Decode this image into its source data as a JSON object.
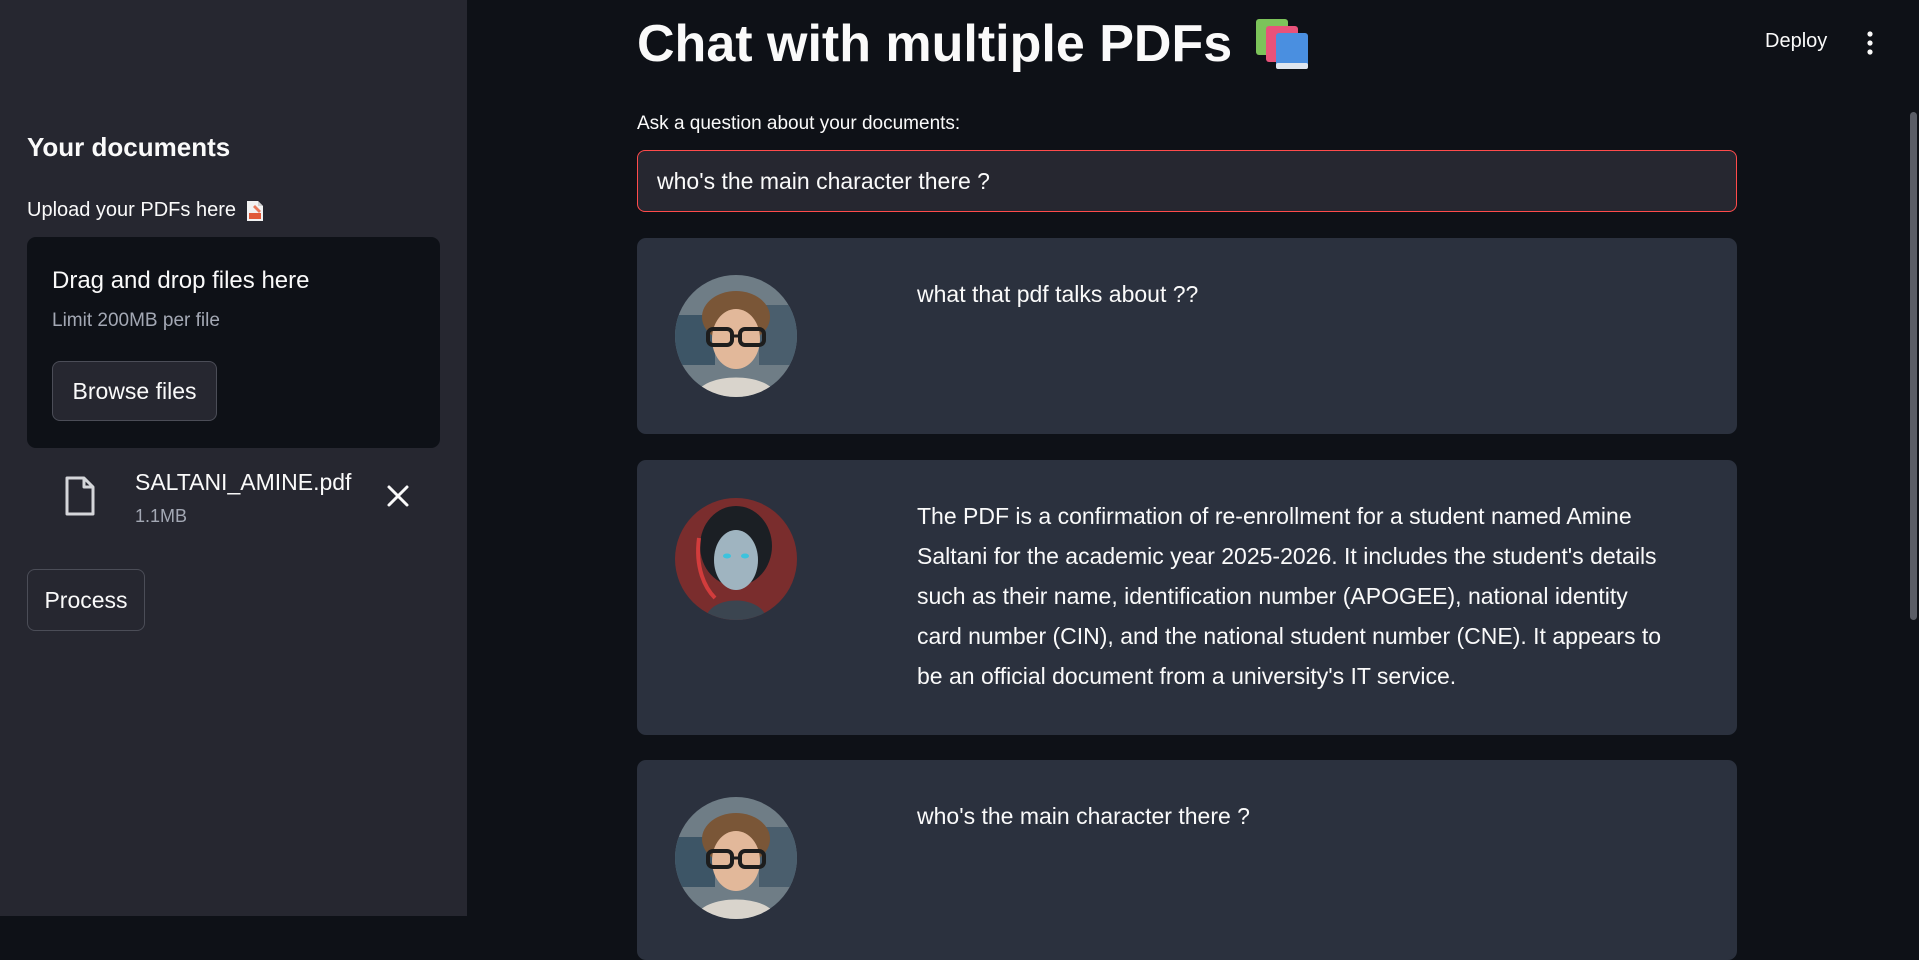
{
  "sidebar": {
    "title": "Your documents",
    "upload_label": "Upload your PDFs here",
    "dropzone": {
      "title": "Drag and drop files here",
      "limit": "Limit 200MB per file",
      "browse_label": "Browse files"
    },
    "file": {
      "name": "SALTANI_AMINE.pdf",
      "size": "1.1MB"
    },
    "process_label": "Process"
  },
  "header": {
    "deploy_label": "Deploy"
  },
  "main": {
    "title": "Chat with multiple PDFs",
    "question_label": "Ask a question about your documents:",
    "question_value": "who's the main character there ?",
    "messages": [
      {
        "role": "user",
        "text": "what that pdf talks about ??"
      },
      {
        "role": "bot",
        "text": "The PDF is a confirmation of re-enrollment for a student named Amine Saltani for the academic year 2025-2026. It includes the student's details such as their name, identification number (APOGEE), national identity card number (CIN), and the national student number (CNE). It appears to be an official document from a university's IT service."
      },
      {
        "role": "user",
        "text": "who's the main character there ?"
      }
    ]
  },
  "colors": {
    "background": "#0e1117",
    "sidebar": "#262730",
    "chat_card": "#2b313e",
    "input_focus_border": "#ff4b4b"
  }
}
